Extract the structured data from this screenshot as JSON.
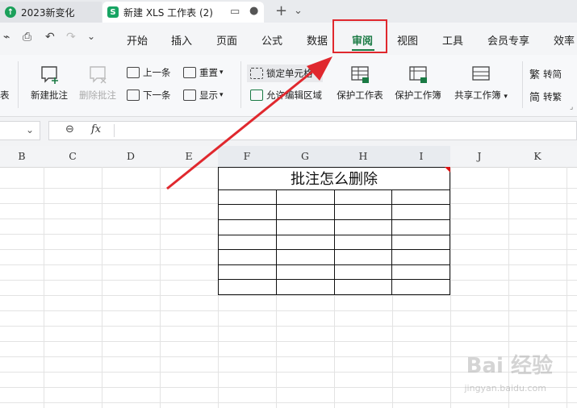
{
  "window": {
    "tabs": [
      {
        "label": "2023新变化",
        "icon": "upload-circle-icon"
      },
      {
        "label": "新建 XLS 工作表 (2)",
        "icon": "spreadsheet-s-icon"
      }
    ],
    "new_tab": "+",
    "menu_chevron": "⌄"
  },
  "menubar": {
    "items": [
      "开始",
      "插入",
      "页面",
      "公式",
      "数据",
      "审阅",
      "视图",
      "工具",
      "会员专享",
      "效率"
    ],
    "active": "审阅",
    "highlight_color": "#e0282e",
    "active_color": "#1a7a44"
  },
  "ribbon": {
    "new_comment": "新建批注",
    "delete_comment": "删除批注",
    "prev": "上一条",
    "next": "下一条",
    "reset": "重置",
    "show": "显示",
    "lock_cell": "锁定单元格",
    "allow_edit": "允许编辑区域",
    "protect_sheet": "保护工作表",
    "protect_book": "保护工作簿",
    "share_book": "共享工作簿",
    "to_simplified": "转简",
    "to_traditional": "转繁",
    "left_cut": "表"
  },
  "formula": {
    "zoom_icon": "magnifier-icon",
    "fx": "fx",
    "value": ""
  },
  "columns": [
    "B",
    "C",
    "D",
    "E",
    "F",
    "G",
    "H",
    "I",
    "J",
    "K"
  ],
  "sheet": {
    "title": "批注怎么删除",
    "rows": 7,
    "cols": 4
  },
  "annotation": {
    "arrow_color": "#e0282e"
  },
  "watermark": {
    "brand": "Bai 经验",
    "url": "jingyan.baidu.com"
  }
}
